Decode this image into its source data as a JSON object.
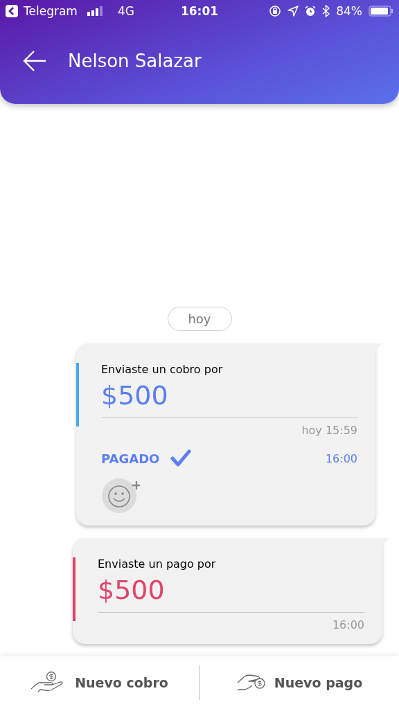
{
  "status_bar": {
    "back_app": "Telegram",
    "network": "4G",
    "time": "16:01",
    "battery": "84%"
  },
  "header": {
    "title": "Nelson Salazar"
  },
  "date_chip": "hoy",
  "messages": [
    {
      "kind": "charge",
      "color": "#4aa8f5",
      "title": "Enviaste un cobro por",
      "amount": "$500",
      "sent_time": "hoy 15:59",
      "status": {
        "label": "PAGADO",
        "time": "16:00"
      },
      "reaction_button": true
    },
    {
      "kind": "payment",
      "color": "#e0436a",
      "title": "Enviaste un pago por",
      "amount": "$500",
      "sent_time": "16:00",
      "reaction_button": false
    }
  ],
  "bottom_bar": [
    {
      "kind": "receive",
      "label": "Nuevo cobro"
    },
    {
      "kind": "pay",
      "label": "Nuevo pago"
    }
  ]
}
